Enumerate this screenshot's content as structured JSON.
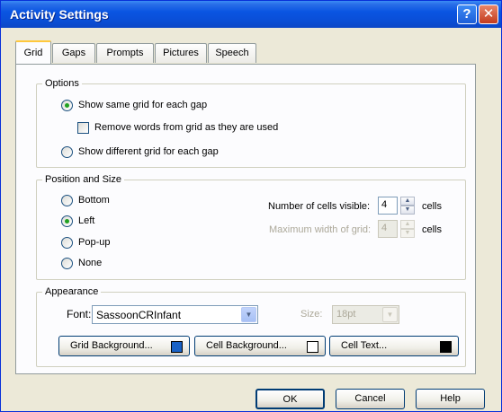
{
  "window": {
    "title": "Activity Settings",
    "help_glyph": "?",
    "close_glyph": "✕"
  },
  "tabs": [
    {
      "label": "Grid",
      "active": true
    },
    {
      "label": "Gaps",
      "active": false
    },
    {
      "label": "Prompts",
      "active": false
    },
    {
      "label": "Pictures",
      "active": false
    },
    {
      "label": "Speech",
      "active": false
    }
  ],
  "options": {
    "legend": "Options",
    "same_grid_label": "Show same grid for each gap",
    "remove_words_label": "Remove words from grid as they are used",
    "different_grid_label": "Show different grid for each gap",
    "selected": "same_grid",
    "remove_words_checked": false
  },
  "position": {
    "legend": "Position and Size",
    "bottom_label": "Bottom",
    "left_label": "Left",
    "popup_label": "Pop-up",
    "none_label": "None",
    "selected": "left",
    "cells_visible_label": "Number of cells visible:",
    "cells_visible_value": "4",
    "cells_unit_1": "cells",
    "max_width_label": "Maximum width of grid:",
    "max_width_value": "4",
    "cells_unit_2": "cells"
  },
  "appearance": {
    "legend": "Appearance",
    "font_label": "Font:",
    "font_value": "SassoonCRInfant",
    "size_label": "Size:",
    "size_value": "18pt",
    "grid_bg_label": "Grid Background...",
    "grid_bg_color": "#1a62c6",
    "cell_bg_label": "Cell Background...",
    "cell_bg_color": "#ffffff",
    "cell_text_label": "Cell Text...",
    "cell_text_color": "#000000"
  },
  "footer": {
    "ok_label": "OK",
    "cancel_label": "Cancel",
    "help_label": "Help"
  },
  "colors": {
    "titlebar": "#0a55e2",
    "dialog_bg": "#ece9d8",
    "panel_bg": "#fcfcfe"
  }
}
